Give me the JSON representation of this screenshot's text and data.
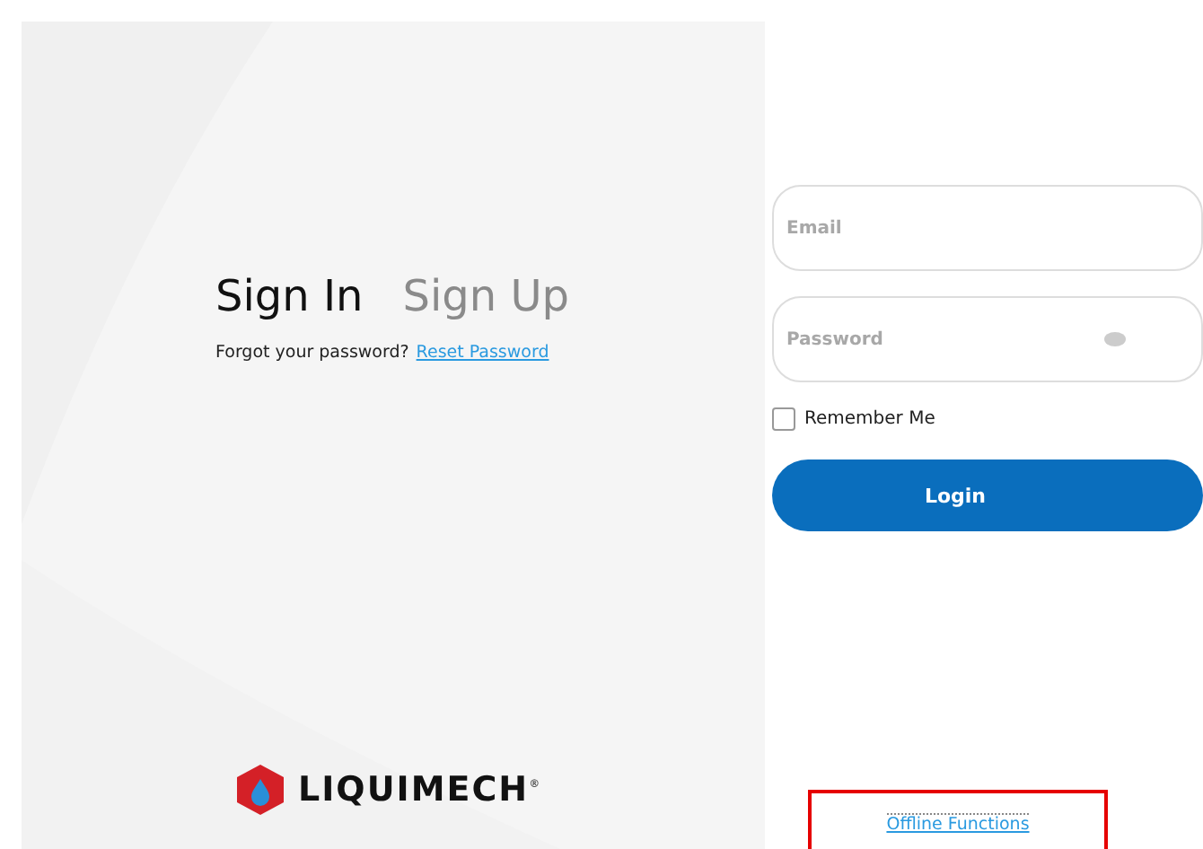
{
  "tabs": [
    {
      "label": "Sign In",
      "selected": true
    },
    {
      "label": "Sign Up",
      "selected": false
    }
  ],
  "forgot": {
    "text": "Forgot your password?",
    "link": "Reset Password"
  },
  "logo": {
    "name": "LIQUIMECH",
    "mark": "®"
  },
  "form": {
    "email": {
      "placeholder": "Email"
    },
    "password": {
      "placeholder": "Password"
    },
    "remember": {
      "label": "Remember Me",
      "checked": false
    },
    "login": "Login"
  },
  "offline": {
    "label": "Offline Functions"
  }
}
